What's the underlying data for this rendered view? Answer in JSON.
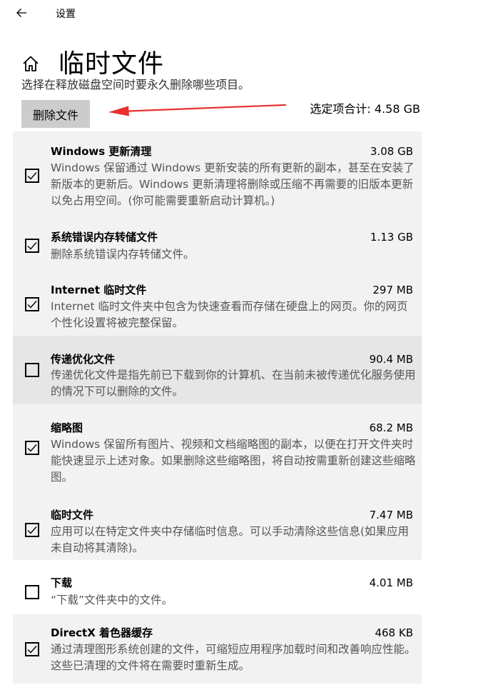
{
  "topbar": {
    "back_icon": "arrow-left-icon",
    "title": "设置"
  },
  "header": {
    "home_icon": "home-icon",
    "title": "临时文件",
    "cutoff_text": "选择在释放磁盘空间时要永久删除哪些项目。"
  },
  "actions": {
    "delete_label": "删除文件",
    "selected_total": "选定项合计: 4.58 GB",
    "arrow_color": "#e8312f"
  },
  "items": [
    {
      "name": "Windows 更新清理",
      "size": "3.08 GB",
      "checked": true,
      "description": "Windows 保留通过 Windows 更新安装的所有更新的副本，甚至在安装了新版本的更新后。Windows 更新清理将删除或压缩不再需要的旧版本更新以免占用空间。(你可能需要重新启动计算机。)"
    },
    {
      "name": "系统错误内存转储文件",
      "size": "1.13 GB",
      "checked": true,
      "description": "删除系统错误内存转储文件。"
    },
    {
      "name": "Internet 临时文件",
      "size": "297 MB",
      "checked": true,
      "description": "Internet 临时文件夹中包含为快速查看而存储在硬盘上的网页。你的网页个性化设置将被完整保留。"
    },
    {
      "name": "传递优化文件",
      "size": "90.4 MB",
      "checked": false,
      "description": "传递优化文件是指先前已下载到你的计算机、在当前未被传递优化服务使用的情况下可以删除的文件。"
    },
    {
      "name": "缩略图",
      "size": "68.2 MB",
      "checked": true,
      "description": "Windows 保留所有图片、视频和文档缩略图的副本，以便在打开文件夹时能快速显示上述对象。如果删除这些缩略图，将自动按需重新创建这些缩略图。"
    },
    {
      "name": "临时文件",
      "size": "7.47 MB",
      "checked": true,
      "description": "应用可以在特定文件夹中存储临时信息。可以手动清除这些信息(如果应用未自动将其清除)。"
    },
    {
      "name": "下载",
      "size": "4.01 MB",
      "checked": false,
      "description": "“下载”文件夹中的文件。"
    },
    {
      "name": "DirectX 着色器缓存",
      "size": "468 KB",
      "checked": true,
      "description": "通过清理图形系统创建的文件，可缩短应用程序加载时间和改善响应性能。这些已清理的文件将在需要时重新生成。"
    }
  ]
}
